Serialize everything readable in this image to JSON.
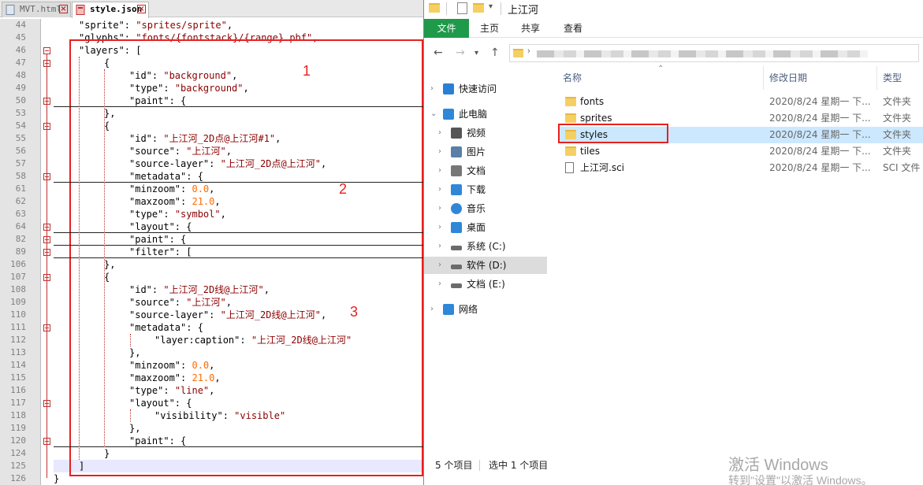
{
  "editor": {
    "tabs": [
      {
        "label": "MVT.html"
      },
      {
        "label": "style.json"
      }
    ],
    "lines": [
      {
        "num": "44",
        "indent": 1,
        "text": [
          [
            "k",
            "\"sprite\""
          ],
          [
            "p",
            ": "
          ],
          [
            "s",
            "\"sprites/sprite\""
          ],
          [
            "p",
            ","
          ]
        ]
      },
      {
        "num": "45",
        "indent": 1,
        "text": [
          [
            "k",
            "\"glyphs\""
          ],
          [
            "p",
            ": "
          ],
          [
            "s",
            "\"fonts/{fontstack}/{range}.pbf\""
          ],
          [
            "p",
            ","
          ]
        ]
      },
      {
        "num": "46",
        "indent": 1,
        "text": [
          [
            "k",
            "\"layers\""
          ],
          [
            "p",
            ": ["
          ]
        ]
      },
      {
        "num": "47",
        "indent": 2,
        "text": [
          [
            "p",
            "{"
          ]
        ]
      },
      {
        "num": "48",
        "indent": 3,
        "text": [
          [
            "k",
            "\"id\""
          ],
          [
            "p",
            ": "
          ],
          [
            "s",
            "\"background\""
          ],
          [
            "p",
            ","
          ]
        ]
      },
      {
        "num": "49",
        "indent": 3,
        "text": [
          [
            "k",
            "\"type\""
          ],
          [
            "p",
            ": "
          ],
          [
            "s",
            "\"background\""
          ],
          [
            "p",
            ","
          ]
        ]
      },
      {
        "num": "50",
        "indent": 3,
        "text": [
          [
            "k",
            "\"paint\""
          ],
          [
            "p",
            ": {"
          ]
        ]
      },
      {
        "num": "53",
        "indent": 2,
        "text": [
          [
            "p",
            "},"
          ]
        ]
      },
      {
        "num": "54",
        "indent": 2,
        "text": [
          [
            "p",
            "{"
          ]
        ]
      },
      {
        "num": "55",
        "indent": 3,
        "text": [
          [
            "k",
            "\"id\""
          ],
          [
            "p",
            ": "
          ],
          [
            "s",
            "\"上江河_2D点@上江河#1\""
          ],
          [
            "p",
            ","
          ]
        ]
      },
      {
        "num": "56",
        "indent": 3,
        "text": [
          [
            "k",
            "\"source\""
          ],
          [
            "p",
            ": "
          ],
          [
            "s",
            "\"上江河\""
          ],
          [
            "p",
            ","
          ]
        ]
      },
      {
        "num": "57",
        "indent": 3,
        "text": [
          [
            "k",
            "\"source-layer\""
          ],
          [
            "p",
            ": "
          ],
          [
            "s",
            "\"上江河_2D点@上江河\""
          ],
          [
            "p",
            ","
          ]
        ]
      },
      {
        "num": "58",
        "indent": 3,
        "text": [
          [
            "k",
            "\"metadata\""
          ],
          [
            "p",
            ": {"
          ]
        ]
      },
      {
        "num": "61",
        "indent": 3,
        "text": [
          [
            "k",
            "\"minzoom\""
          ],
          [
            "p",
            ": "
          ],
          [
            "n",
            "0.0"
          ],
          [
            "p",
            ","
          ]
        ]
      },
      {
        "num": "62",
        "indent": 3,
        "text": [
          [
            "k",
            "\"maxzoom\""
          ],
          [
            "p",
            ": "
          ],
          [
            "n",
            "21.0"
          ],
          [
            "p",
            ","
          ]
        ]
      },
      {
        "num": "63",
        "indent": 3,
        "text": [
          [
            "k",
            "\"type\""
          ],
          [
            "p",
            ": "
          ],
          [
            "s",
            "\"symbol\""
          ],
          [
            "p",
            ","
          ]
        ]
      },
      {
        "num": "64",
        "indent": 3,
        "text": [
          [
            "k",
            "\"layout\""
          ],
          [
            "p",
            ": {"
          ]
        ]
      },
      {
        "num": "82",
        "indent": 3,
        "text": [
          [
            "k",
            "\"paint\""
          ],
          [
            "p",
            ": {"
          ]
        ]
      },
      {
        "num": "89",
        "indent": 3,
        "text": [
          [
            "k",
            "\"filter\""
          ],
          [
            "p",
            ": ["
          ]
        ]
      },
      {
        "num": "106",
        "indent": 2,
        "text": [
          [
            "p",
            "},"
          ]
        ]
      },
      {
        "num": "107",
        "indent": 2,
        "text": [
          [
            "p",
            "{"
          ]
        ]
      },
      {
        "num": "108",
        "indent": 3,
        "text": [
          [
            "k",
            "\"id\""
          ],
          [
            "p",
            ": "
          ],
          [
            "s",
            "\"上江河_2D线@上江河\""
          ],
          [
            "p",
            ","
          ]
        ]
      },
      {
        "num": "109",
        "indent": 3,
        "text": [
          [
            "k",
            "\"source\""
          ],
          [
            "p",
            ": "
          ],
          [
            "s",
            "\"上江河\""
          ],
          [
            "p",
            ","
          ]
        ]
      },
      {
        "num": "110",
        "indent": 3,
        "text": [
          [
            "k",
            "\"source-layer\""
          ],
          [
            "p",
            ": "
          ],
          [
            "s",
            "\"上江河_2D线@上江河\""
          ],
          [
            "p",
            ","
          ]
        ]
      },
      {
        "num": "111",
        "indent": 3,
        "text": [
          [
            "k",
            "\"metadata\""
          ],
          [
            "p",
            ": {"
          ]
        ]
      },
      {
        "num": "112",
        "indent": 4,
        "text": [
          [
            "k",
            "\"layer:caption\""
          ],
          [
            "p",
            ": "
          ],
          [
            "s",
            "\"上江河_2D线@上江河\""
          ]
        ]
      },
      {
        "num": "113",
        "indent": 3,
        "text": [
          [
            "p",
            "},"
          ]
        ]
      },
      {
        "num": "114",
        "indent": 3,
        "text": [
          [
            "k",
            "\"minzoom\""
          ],
          [
            "p",
            ": "
          ],
          [
            "n",
            "0.0"
          ],
          [
            "p",
            ","
          ]
        ]
      },
      {
        "num": "115",
        "indent": 3,
        "text": [
          [
            "k",
            "\"maxzoom\""
          ],
          [
            "p",
            ": "
          ],
          [
            "n",
            "21.0"
          ],
          [
            "p",
            ","
          ]
        ]
      },
      {
        "num": "116",
        "indent": 3,
        "text": [
          [
            "k",
            "\"type\""
          ],
          [
            "p",
            ": "
          ],
          [
            "s",
            "\"line\""
          ],
          [
            "p",
            ","
          ]
        ]
      },
      {
        "num": "117",
        "indent": 3,
        "text": [
          [
            "k",
            "\"layout\""
          ],
          [
            "p",
            ": {"
          ]
        ]
      },
      {
        "num": "118",
        "indent": 4,
        "text": [
          [
            "k",
            "\"visibility\""
          ],
          [
            "p",
            ": "
          ],
          [
            "s",
            "\"visible\""
          ]
        ]
      },
      {
        "num": "119",
        "indent": 3,
        "text": [
          [
            "p",
            "},"
          ]
        ]
      },
      {
        "num": "120",
        "indent": 3,
        "text": [
          [
            "k",
            "\"paint\""
          ],
          [
            "p",
            ": {"
          ]
        ]
      },
      {
        "num": "124",
        "indent": 2,
        "text": [
          [
            "p",
            "}"
          ]
        ]
      },
      {
        "num": "125",
        "indent": 1,
        "text": [
          [
            "p",
            "]"
          ]
        ]
      },
      {
        "num": "126",
        "indent": 0,
        "text": [
          [
            "p",
            "}"
          ]
        ]
      }
    ],
    "annotations": [
      "1",
      "2",
      "3"
    ]
  },
  "explorer": {
    "title": "上江河",
    "ribbon_tabs": [
      "文件",
      "主页",
      "共享",
      "查看"
    ],
    "nav": [
      {
        "label": "快速访问",
        "icon": "star-icon"
      },
      {
        "label": "此电脑",
        "icon": "computer-icon"
      },
      {
        "label": "视频",
        "icon": "video-icon"
      },
      {
        "label": "图片",
        "icon": "picture-icon"
      },
      {
        "label": "文档",
        "icon": "document-icon"
      },
      {
        "label": "下载",
        "icon": "download-icon"
      },
      {
        "label": "音乐",
        "icon": "music-icon"
      },
      {
        "label": "桌面",
        "icon": "desktop-icon"
      },
      {
        "label": "系统 (C:)",
        "icon": "drive-icon"
      },
      {
        "label": "软件 (D:)",
        "icon": "drive-icon"
      },
      {
        "label": "文档 (E:)",
        "icon": "drive-icon"
      },
      {
        "label": "网络",
        "icon": "network-icon"
      }
    ],
    "columns": {
      "name": "名称",
      "date": "修改日期",
      "type": "类型"
    },
    "files": [
      {
        "name": "fonts",
        "date": "2020/8/24 星期一 下...",
        "type": "文件夹",
        "kind": "folder"
      },
      {
        "name": "sprites",
        "date": "2020/8/24 星期一 下...",
        "type": "文件夹",
        "kind": "folder"
      },
      {
        "name": "styles",
        "date": "2020/8/24 星期一 下...",
        "type": "文件夹",
        "kind": "folder"
      },
      {
        "name": "tiles",
        "date": "2020/8/24 星期一 下...",
        "type": "文件夹",
        "kind": "folder"
      },
      {
        "name": "上江河.sci",
        "date": "2020/8/24 星期一 下...",
        "type": "SCI 文件",
        "kind": "file"
      }
    ],
    "status": {
      "count": "5 个项目",
      "selected": "选中 1 个项目"
    },
    "watermark": {
      "line1": "激活 Windows",
      "line2": "转到\"设置\"以激活 Windows。"
    }
  }
}
